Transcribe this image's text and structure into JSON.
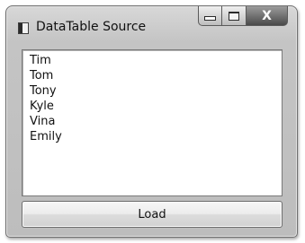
{
  "window": {
    "title": "DataTable Source",
    "icon": "window-app-icon"
  },
  "caption_buttons": {
    "minimize_icon": "minimize-icon",
    "maximize_icon": "maximize-icon",
    "close_glyph": "X"
  },
  "list": {
    "items": [
      "Tim",
      "Tom",
      "Tony",
      "Kyle",
      "Vina",
      "Emily"
    ]
  },
  "load_button": {
    "label": "Load"
  }
}
